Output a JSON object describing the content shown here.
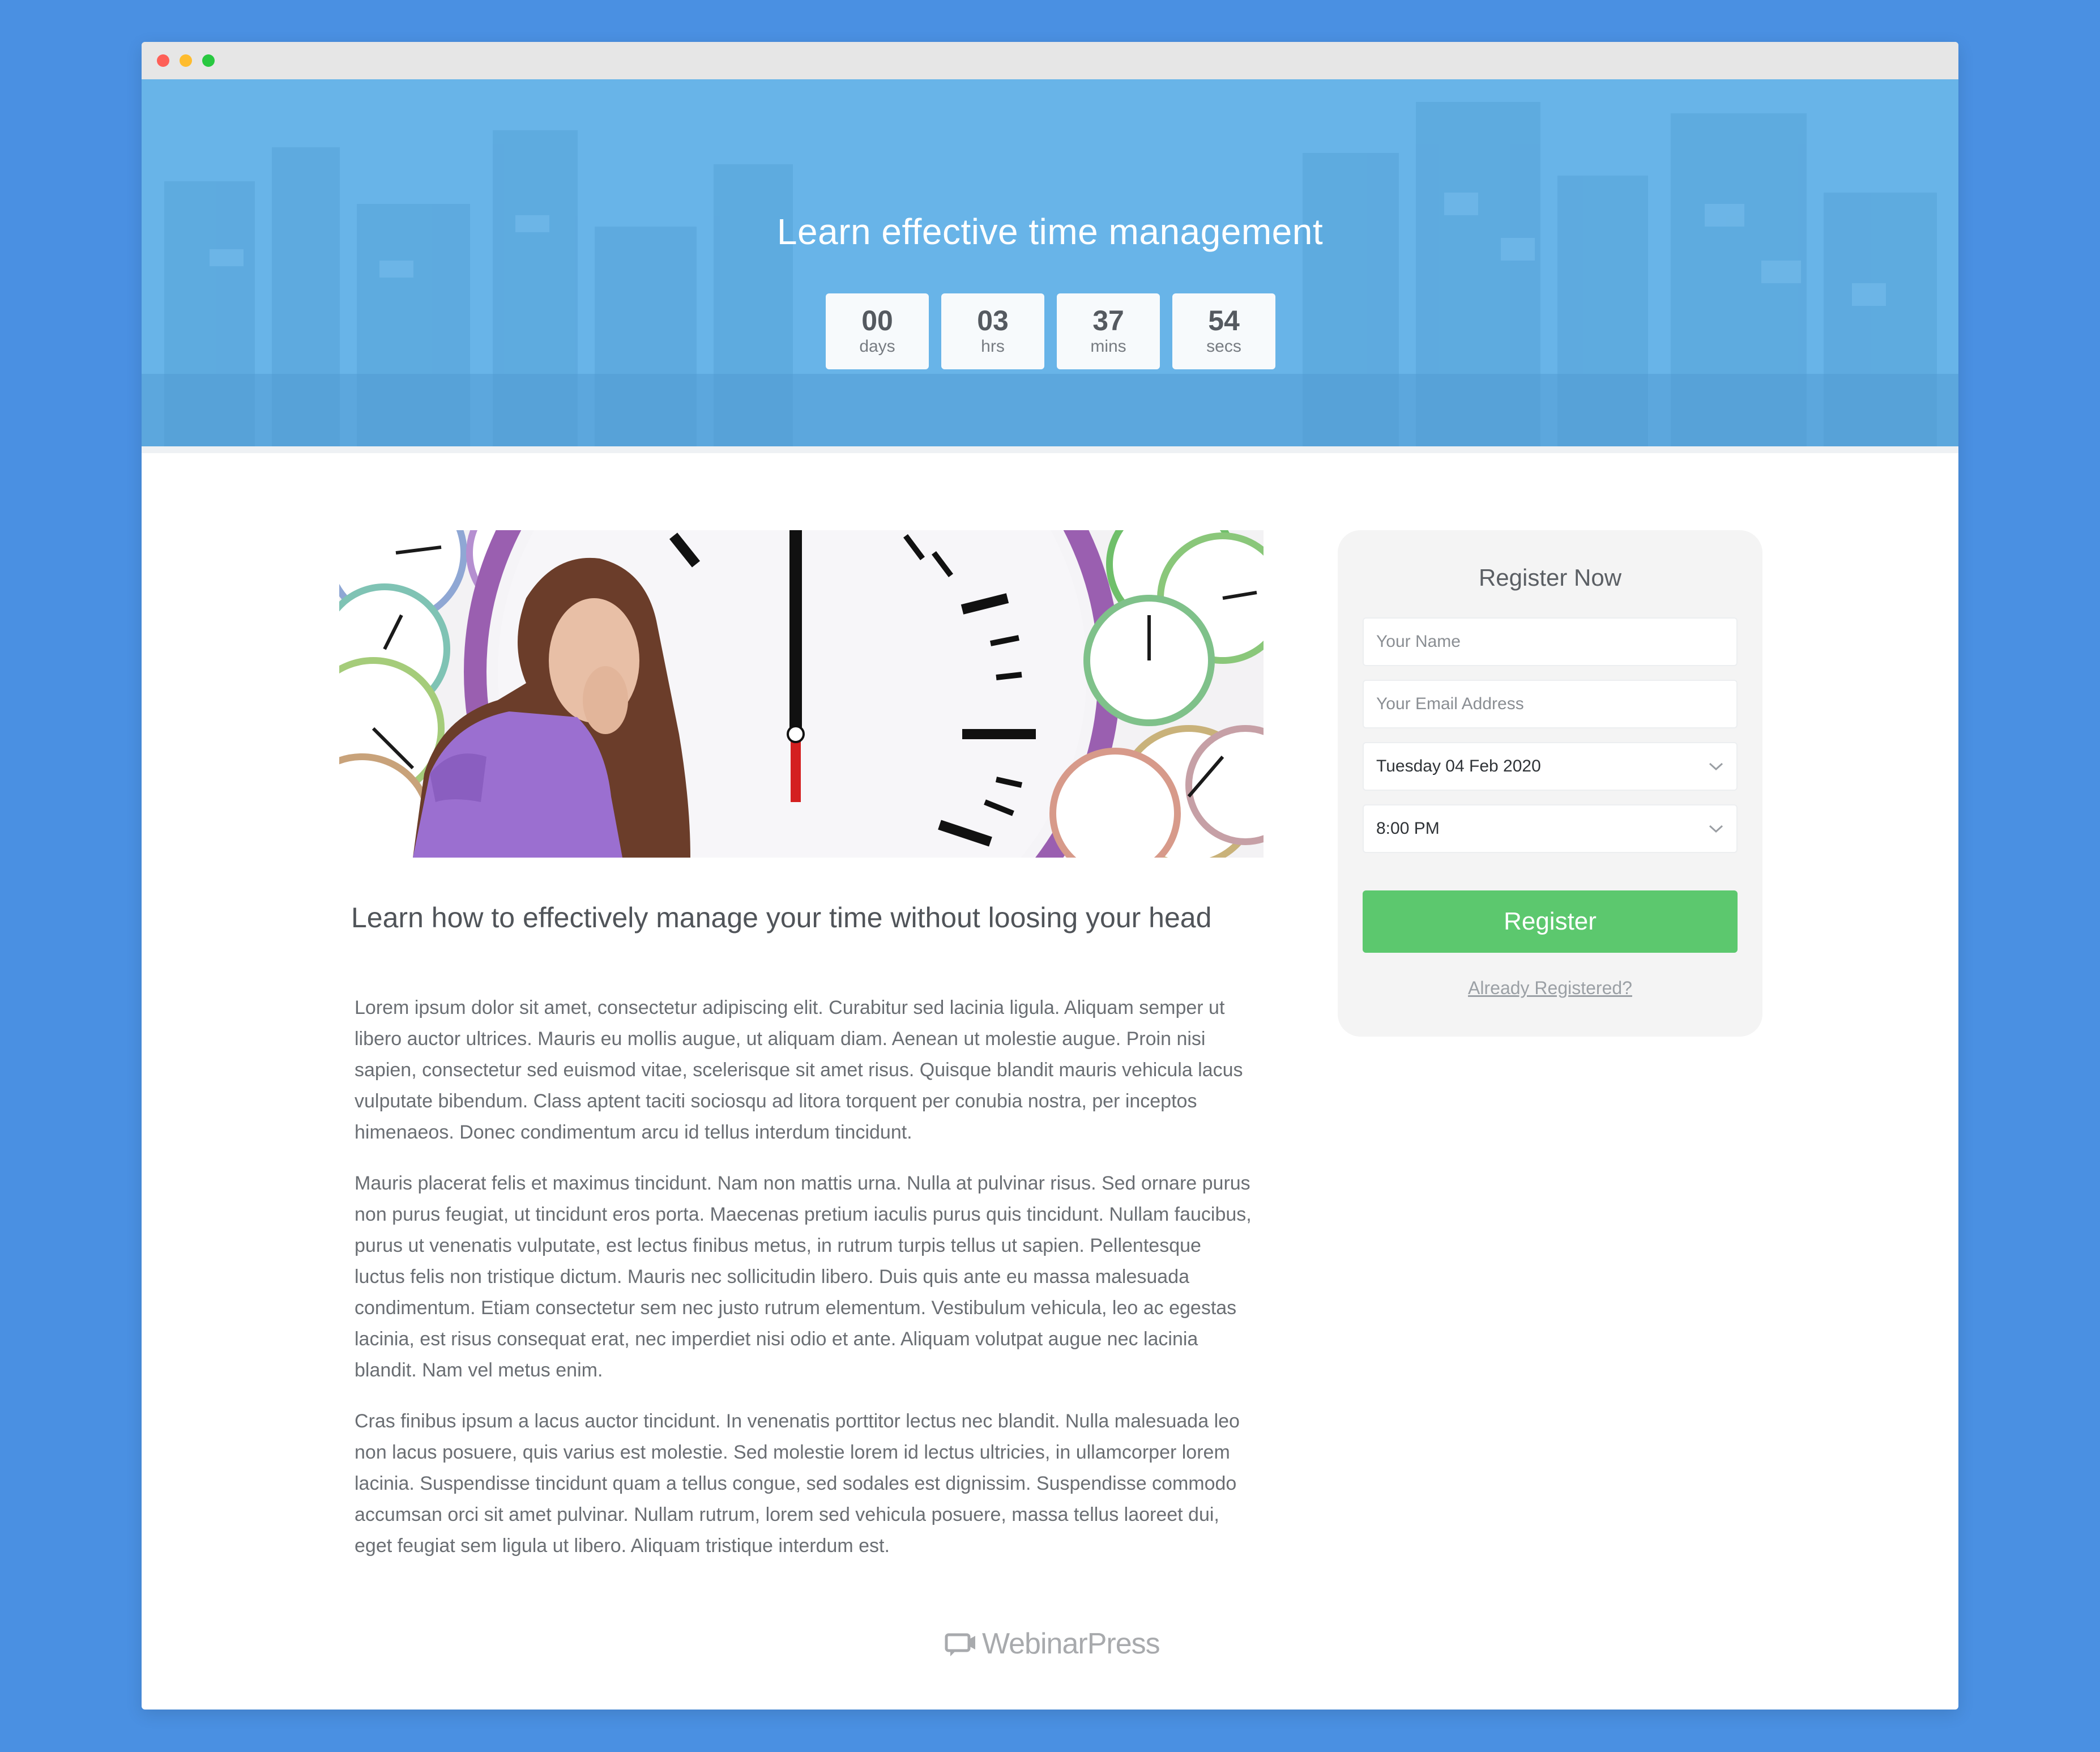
{
  "hero": {
    "title": "Learn effective time management",
    "countdown": [
      {
        "value": "00",
        "unit": "days"
      },
      {
        "value": "03",
        "unit": "hrs"
      },
      {
        "value": "37",
        "unit": "mins"
      },
      {
        "value": "54",
        "unit": "secs"
      }
    ]
  },
  "article": {
    "headline": "Learn how to effectively manage your time without loosing your head",
    "paragraphs": [
      "Lorem ipsum dolor sit amet, consectetur adipiscing elit. Curabitur sed lacinia ligula. Aliquam semper ut libero auctor ultrices. Mauris eu mollis augue, ut aliquam diam. Aenean ut molestie augue. Proin nisi sapien, consectetur sed euismod vitae, scelerisque sit amet risus. Quisque blandit mauris vehicula lacus vulputate bibendum. Class aptent taciti sociosqu ad litora torquent per conubia nostra, per inceptos himenaeos. Donec condimentum arcu id tellus interdum tincidunt.",
      "Mauris placerat felis et maximus tincidunt. Nam non mattis urna. Nulla at pulvinar risus. Sed ornare purus non purus feugiat, ut tincidunt eros porta. Maecenas pretium iaculis purus quis tincidunt. Nullam faucibus, purus ut venenatis vulputate, est lectus finibus metus, in rutrum turpis tellus ut sapien. Pellentesque luctus felis non tristique dictum. Mauris nec sollicitudin libero. Duis quis ante eu massa malesuada condimentum. Etiam consectetur sem nec justo rutrum elementum. Vestibulum vehicula, leo ac egestas lacinia, est risus consequat erat, nec imperdiet nisi odio et ante. Aliquam volutpat augue nec lacinia blandit. Nam vel metus enim.",
      "Cras finibus ipsum a lacus auctor tincidunt. In venenatis porttitor lectus nec blandit. Nulla malesuada leo non lacus posuere, quis varius est molestie. Sed molestie lorem id lectus ultricies, in ullamcorper lorem lacinia. Suspendisse tincidunt quam a tellus congue, sed sodales est dignissim. Suspendisse commodo accumsan orci sit amet pulvinar. Nullam rutrum, lorem sed vehicula posuere, massa tellus laoreet dui, eget feugiat sem ligula ut libero. Aliquam tristique interdum est."
    ]
  },
  "register": {
    "title": "Register Now",
    "name_placeholder": "Your Name",
    "email_placeholder": "Your Email Address",
    "date_value": "Tuesday 04 Feb 2020",
    "time_value": "8:00 PM",
    "button_label": "Register",
    "already_link": "Already Registered?"
  },
  "footer": {
    "brand": "WebinarPress",
    "brand_icon": "video-chat-icon"
  },
  "colors": {
    "page_bg": "#4a90e2",
    "hero_bg": "#68b4e8",
    "register_button": "#5cc86e"
  }
}
